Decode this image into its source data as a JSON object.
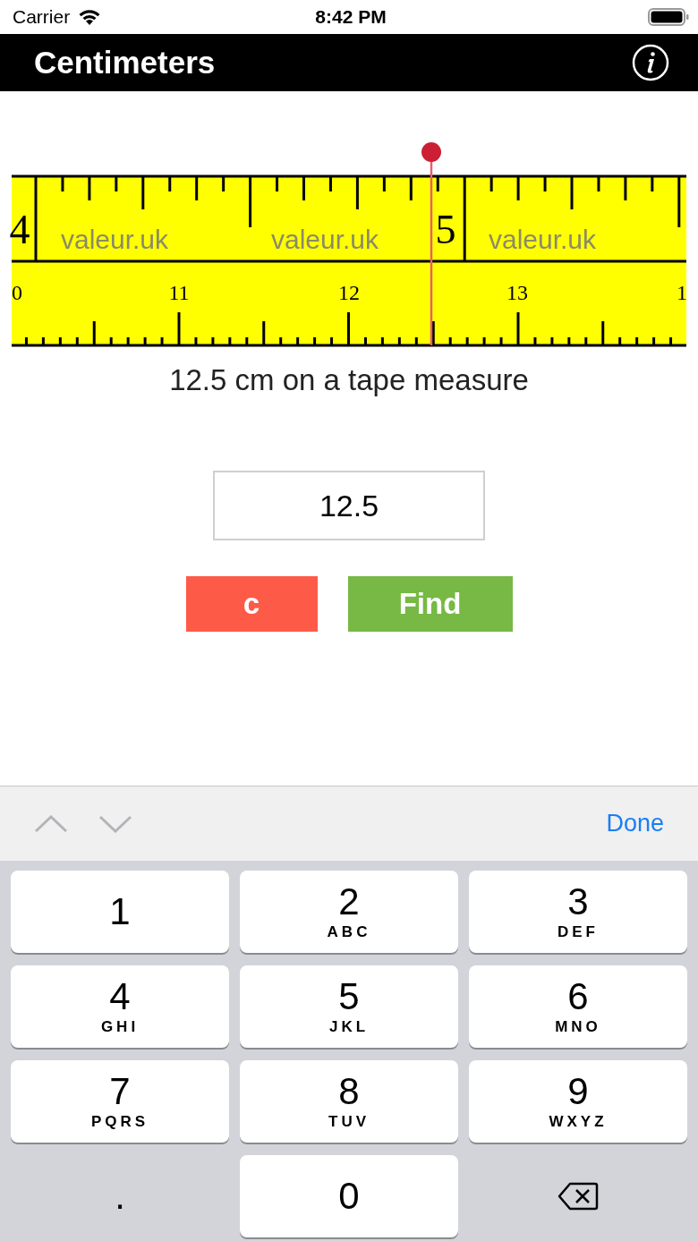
{
  "status_bar": {
    "carrier": "Carrier",
    "time": "8:42 PM"
  },
  "nav_bar": {
    "title": "Centimeters"
  },
  "tape": {
    "inch_labels": [
      "4",
      "5"
    ],
    "brand_labels": [
      "valeur.uk",
      "valeur.uk",
      "valeur.uk"
    ],
    "cm_labels": [
      "0",
      "11",
      "12",
      "13",
      "1"
    ],
    "caption": "12.5 cm on a tape measure"
  },
  "input": {
    "value": "12.5"
  },
  "buttons": [
    {
      "label": "c",
      "kind": "clear"
    },
    {
      "label": "Find",
      "kind": "find"
    }
  ],
  "keyboard": {
    "done": "Done",
    "keys": [
      {
        "kind": "digit",
        "digit": "1"
      },
      {
        "kind": "digit",
        "digit": "2",
        "letters": "ABC"
      },
      {
        "kind": "digit",
        "digit": "3",
        "letters": "DEF"
      },
      {
        "kind": "digit",
        "digit": "4",
        "letters": "GHI"
      },
      {
        "kind": "digit",
        "digit": "5",
        "letters": "JKL"
      },
      {
        "kind": "digit",
        "digit": "6",
        "letters": "MNO"
      },
      {
        "kind": "digit",
        "digit": "7",
        "letters": "PQRS"
      },
      {
        "kind": "digit",
        "digit": "8",
        "letters": "TUV"
      },
      {
        "kind": "digit",
        "digit": "9",
        "letters": "WXYZ"
      },
      {
        "kind": "plain",
        "digit": "."
      },
      {
        "kind": "digit",
        "digit": "0"
      },
      {
        "kind": "delete"
      }
    ]
  }
}
